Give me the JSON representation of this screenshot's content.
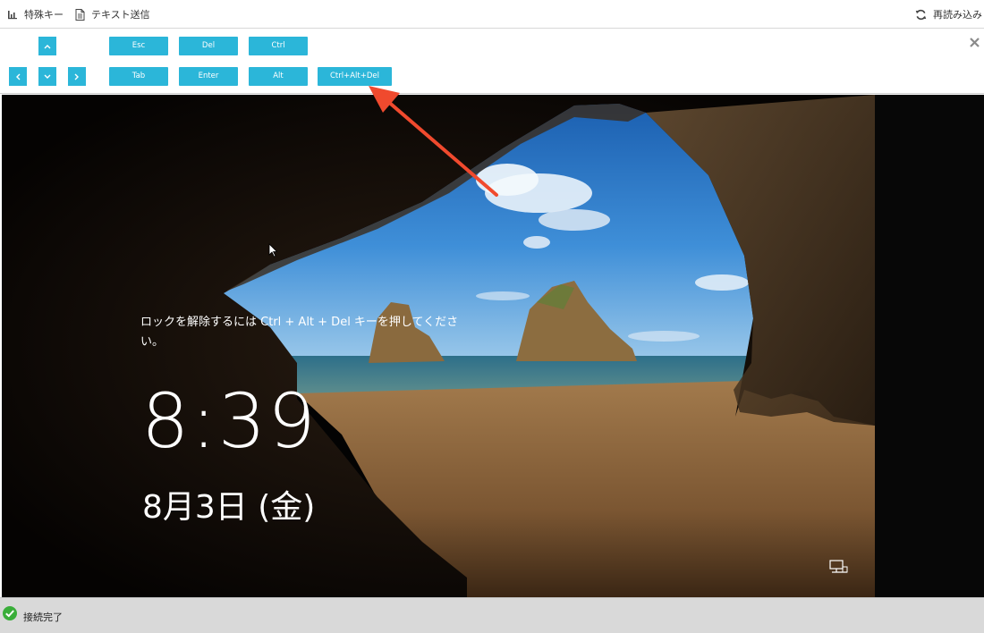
{
  "toolbar": {
    "special_keys_label": "特殊キー",
    "send_text_label": "テキスト送信",
    "reload_label": "再読み込み"
  },
  "keys": {
    "up": "^",
    "left": "<",
    "down": "v",
    "right": ">",
    "esc": "Esc",
    "del": "Del",
    "ctrl": "Ctrl",
    "tab": "Tab",
    "enter": "Enter",
    "alt": "Alt",
    "ctrl_alt_del": "Ctrl+Alt+Del"
  },
  "lockscreen": {
    "message": "ロックを解除するには Ctrl + Alt + Del キーを押してください。",
    "time": "8:39",
    "date": "8月3日 (金)"
  },
  "status": {
    "text": "接続完了"
  },
  "colors": {
    "key_bg": "#2bb6d9",
    "annotation_arrow": "#f04a2e",
    "status_ok": "#3aae3a"
  },
  "icons": {
    "special_keys": "bar-chart-icon",
    "send_text": "document-icon",
    "reload": "refresh-icon",
    "close": "close-icon",
    "network": "network-icon",
    "status": "check-circle-icon"
  }
}
